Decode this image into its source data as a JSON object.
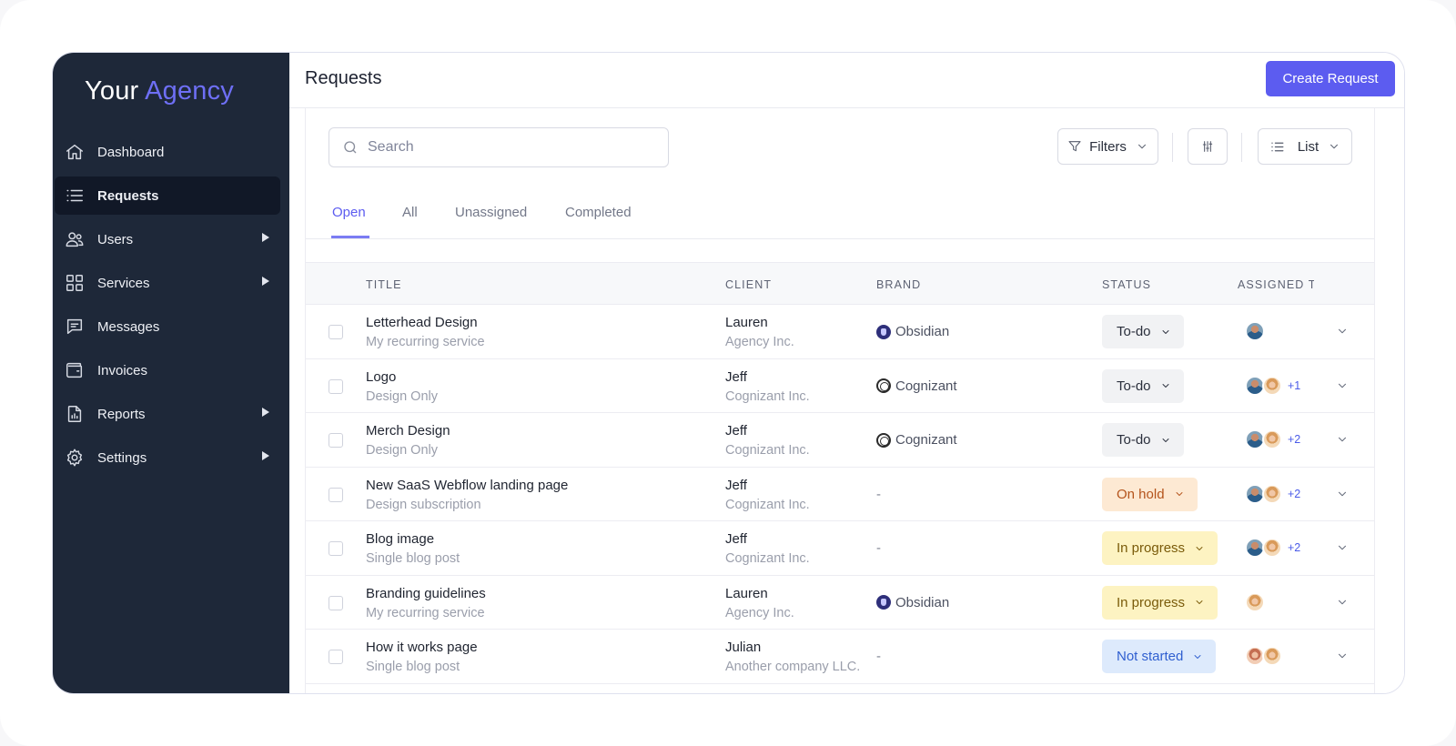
{
  "sidebar": {
    "logo_part1": "Your",
    "logo_part2": "Agency",
    "items": [
      {
        "label": "Dashboard",
        "icon": "home-icon",
        "active": false,
        "has_submenu": false
      },
      {
        "label": "Requests",
        "icon": "list-icon",
        "active": true,
        "has_submenu": false
      },
      {
        "label": "Users",
        "icon": "users-icon",
        "active": false,
        "has_submenu": true
      },
      {
        "label": "Services",
        "icon": "grid-icon",
        "active": false,
        "has_submenu": true
      },
      {
        "label": "Messages",
        "icon": "message-icon",
        "active": false,
        "has_submenu": false
      },
      {
        "label": "Invoices",
        "icon": "wallet-icon",
        "active": false,
        "has_submenu": false
      },
      {
        "label": "Reports",
        "icon": "report-icon",
        "active": false,
        "has_submenu": true
      },
      {
        "label": "Settings",
        "icon": "gear-icon",
        "active": false,
        "has_submenu": true
      }
    ]
  },
  "header": {
    "title": "Requests",
    "create_label": "Create Request"
  },
  "toolbar": {
    "search_placeholder": "Search",
    "filters_label": "Filters",
    "view_label": "List"
  },
  "tabs": [
    {
      "label": "Open",
      "active": true
    },
    {
      "label": "All",
      "active": false
    },
    {
      "label": "Unassigned",
      "active": false
    },
    {
      "label": "Completed",
      "active": false
    }
  ],
  "table": {
    "columns": [
      "TITLE",
      "CLIENT",
      "BRAND",
      "STATUS",
      "ASSIGNED TO"
    ],
    "rows": [
      {
        "title": "Letterhead Design",
        "subtitle": "My recurring service",
        "client": "Lauren",
        "company": "Agency Inc.",
        "brand": "Obsidian",
        "brand_logo": "obsidian",
        "status": "To-do",
        "status_kind": "todo",
        "assignees": [
          "m"
        ],
        "extra": ""
      },
      {
        "title": "Logo",
        "subtitle": "Design Only",
        "client": "Jeff",
        "company": "Cognizant Inc.",
        "brand": "Cognizant",
        "brand_logo": "cognizant",
        "status": "To-do",
        "status_kind": "todo",
        "assignees": [
          "m",
          "f"
        ],
        "extra": "+1"
      },
      {
        "title": "Merch Design",
        "subtitle": "Design Only",
        "client": "Jeff",
        "company": "Cognizant Inc.",
        "brand": "Cognizant",
        "brand_logo": "cognizant",
        "status": "To-do",
        "status_kind": "todo",
        "assignees": [
          "m",
          "f"
        ],
        "extra": "+2"
      },
      {
        "title": "New SaaS Webflow landing page",
        "subtitle": "Design subscription",
        "client": "Jeff",
        "company": "Cognizant Inc.",
        "brand": "-",
        "brand_logo": "",
        "status": "On hold",
        "status_kind": "hold",
        "assignees": [
          "m",
          "f"
        ],
        "extra": "+2"
      },
      {
        "title": "Blog image",
        "subtitle": "Single blog post",
        "client": "Jeff",
        "company": "Cognizant Inc.",
        "brand": "-",
        "brand_logo": "",
        "status": "In progress",
        "status_kind": "prog",
        "assignees": [
          "m",
          "f"
        ],
        "extra": "+2"
      },
      {
        "title": "Branding guidelines",
        "subtitle": "My recurring service",
        "client": "Lauren",
        "company": "Agency Inc.",
        "brand": "Obsidian",
        "brand_logo": "obsidian",
        "status": "In progress",
        "status_kind": "prog",
        "assignees": [
          "f"
        ],
        "extra": ""
      },
      {
        "title": "How it works page",
        "subtitle": "Single blog post",
        "client": "Julian",
        "company": "Another company LLC.",
        "brand": "-",
        "brand_logo": "",
        "status": "Not started",
        "status_kind": "ns",
        "assignees": [
          "f2",
          "f"
        ],
        "extra": ""
      }
    ]
  }
}
